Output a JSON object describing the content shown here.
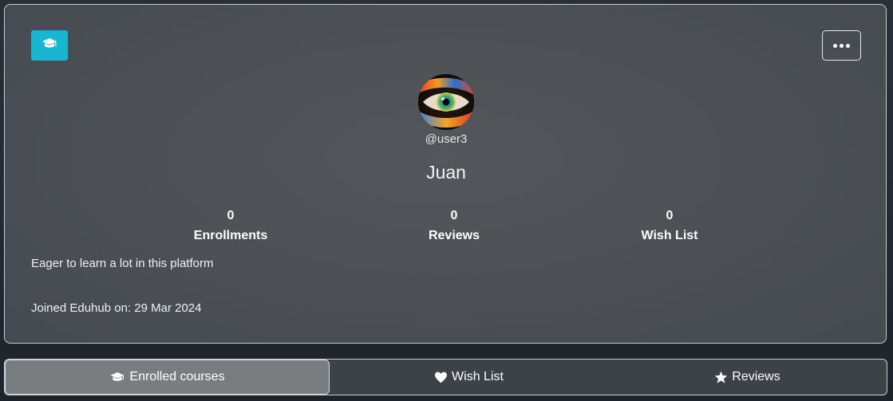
{
  "profile": {
    "username": "@user3",
    "display_name": "Juan",
    "bio": "Eager to learn a lot in this platform",
    "joined": "Joined Eduhub on: 29 Mar 2024",
    "badge_icon": "graduation-cap-icon",
    "badge_color": "#19b6d1"
  },
  "stats": [
    {
      "value": "0",
      "label": "Enrollments"
    },
    {
      "value": "0",
      "label": "Reviews"
    },
    {
      "value": "0",
      "label": "Wish List"
    }
  ],
  "tabs": [
    {
      "label": "Enrolled courses",
      "icon": "graduation-cap-icon",
      "active": true
    },
    {
      "label": "Wish List",
      "icon": "heart-icon",
      "active": false
    },
    {
      "label": "Reviews",
      "icon": "star-icon",
      "active": false
    }
  ]
}
